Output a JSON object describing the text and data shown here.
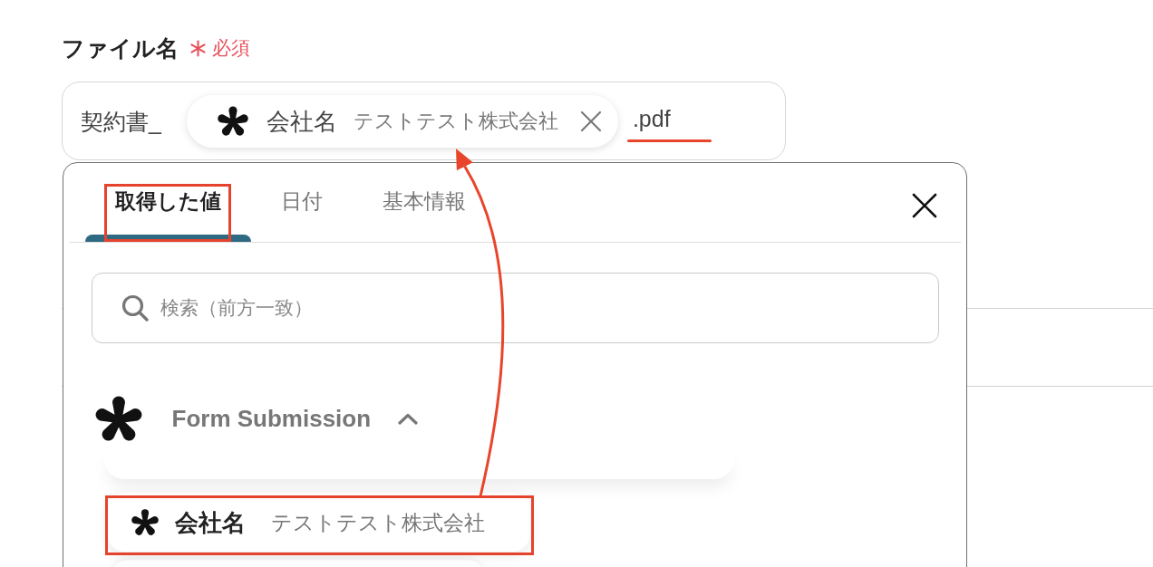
{
  "field": {
    "label": "ファイル名",
    "required": true,
    "required_text": "必須",
    "prefix": "契約書_",
    "token": {
      "name": "会社名",
      "value": "テストテスト株式会社"
    },
    "suffix": {
      "text": ".pdf",
      "underlined": true
    }
  },
  "picker": {
    "tabs": [
      {
        "label": "取得した値",
        "selected": true,
        "highlighted": true
      },
      {
        "label": "日付",
        "selected": false,
        "highlighted": false
      },
      {
        "label": "基本情報",
        "selected": false,
        "highlighted": false
      }
    ],
    "search": {
      "placeholder": "検索（前方一致）"
    },
    "group": {
      "title": "Form Submission",
      "expanded": true
    },
    "items": [
      {
        "name": "会社名",
        "value": "テストテスト株式会社",
        "highlighted": true
      }
    ]
  }
}
